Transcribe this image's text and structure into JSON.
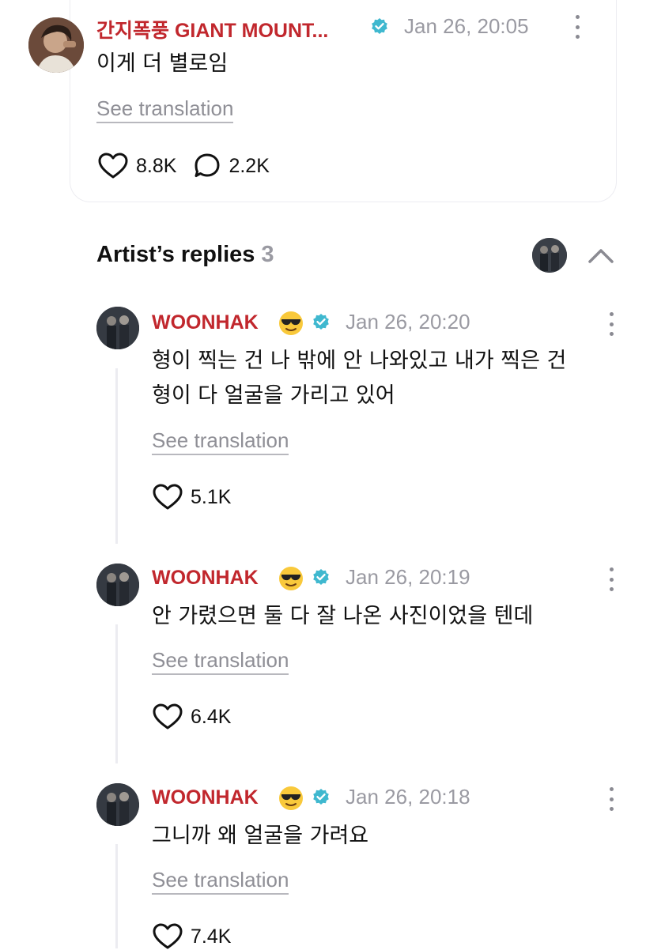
{
  "post": {
    "author": "간지폭풍 GIANT MOUNT...",
    "date": "Jan 26, 20:05",
    "text": "이게 더 별로임",
    "see_translation": "See translation",
    "likes": "8.8K",
    "comments": "2.2K"
  },
  "artist_replies": {
    "title": "Artist’s replies",
    "count": "3",
    "replies": [
      {
        "author": "WOONHAK",
        "date": "Jan 26, 20:20",
        "lines": [
          "형이 찍는 건 나 밖에 안 나와있고 내가 찍은 건",
          "형이 다 얼굴을 가리고 있어"
        ],
        "see_translation": "See translation",
        "likes": "5.1K"
      },
      {
        "author": "WOONHAK",
        "date": "Jan 26, 20:19",
        "lines": [
          "안 가렸으면 둘 다 잘 나온 사진이었을 텐데"
        ],
        "see_translation": "See translation",
        "likes": "6.4K"
      },
      {
        "author": "WOONHAK",
        "date": "Jan 26, 20:18",
        "lines": [
          "그니까 왜 얼굴을 가려요"
        ],
        "see_translation": "See translation",
        "likes": "7.4K"
      }
    ]
  },
  "icons": {
    "verified": "verified-badge-icon",
    "more": "more-vertical-icon",
    "like": "heart-icon",
    "comment": "comment-bubble-icon",
    "collapse": "chevron-up-icon",
    "emoji": "sunglasses-emoji-icon"
  },
  "colors": {
    "author_name": "#c1272d",
    "verified_badge": "#3fb8cf",
    "meta_gray": "#9a9aa2"
  }
}
